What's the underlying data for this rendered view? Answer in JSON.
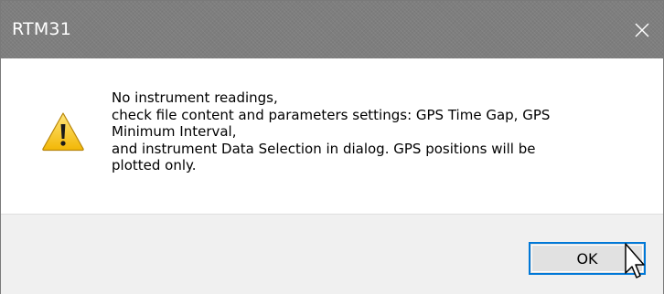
{
  "window": {
    "title": "RTM31",
    "close_glyph": "✕"
  },
  "message": {
    "icon": "warning-icon",
    "lines": [
      "No instrument readings,",
      "check file content and parameters settings: GPS Time Gap, GPS",
      "Minimum Interval,",
      "and instrument Data Selection in dialog. GPS positions will be",
      "plotted only."
    ]
  },
  "buttons": {
    "ok_label": "OK"
  },
  "colors": {
    "titlebar": "#7e7e7e",
    "footer": "#f0f0f0",
    "button_focus_border": "#0078d7",
    "warning_yellow": "#f7c815"
  }
}
